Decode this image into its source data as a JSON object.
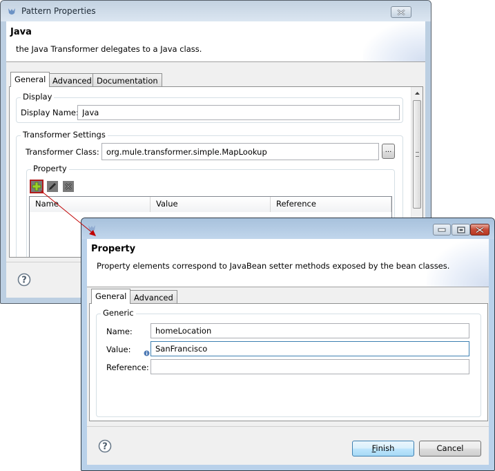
{
  "pattern_dialog": {
    "title": "Pattern Properties",
    "banner_title": "Java",
    "banner_description": "the Java Transformer delegates to a Java class.",
    "tabs": [
      {
        "label": "General",
        "active": true
      },
      {
        "label": "Advanced",
        "active": false
      },
      {
        "label": "Documentation",
        "active": false
      }
    ],
    "display_group": {
      "label": "Display",
      "display_name_label": "Display Name:",
      "display_name_value": "Java"
    },
    "transformer_group": {
      "label": "Transformer Settings",
      "class_label": "Transformer Class:",
      "class_value": "org.mule.transformer.simple.MapLookup",
      "browse_label": "..."
    },
    "property_group": {
      "label": "Property",
      "toolbar": [
        {
          "icon": "add-icon",
          "highlighted": true
        },
        {
          "icon": "edit-icon",
          "highlighted": false
        },
        {
          "icon": "delete-icon",
          "highlighted": false
        }
      ],
      "columns": [
        "Name",
        "Value",
        "Reference"
      ],
      "rows": []
    },
    "close_icon": "close-icon",
    "help_icon": "help-icon"
  },
  "property_dialog": {
    "title": "",
    "banner_title": "Property",
    "banner_description": "Property elements correspond to JavaBean setter methods exposed by the bean classes.",
    "tabs": [
      {
        "label": "General",
        "active": true
      },
      {
        "label": "Advanced",
        "active": false
      }
    ],
    "generic_group": {
      "label": "Generic",
      "fields": [
        {
          "label": "Name:",
          "value": "homeLocation",
          "focused": false
        },
        {
          "label": "Value:",
          "value": "SanFrancisco",
          "focused": true
        },
        {
          "label": "Reference:",
          "value": "",
          "focused": false
        }
      ]
    },
    "buttons": {
      "finish_mnemonic": "F",
      "finish_rest": "inish",
      "cancel": "Cancel"
    },
    "window_controls": [
      "minimize-icon",
      "maximize-icon",
      "close-icon"
    ],
    "help_icon": "help-icon"
  },
  "annotation": {
    "color": "#c00000",
    "description": "arrow from add button to Property dialog"
  }
}
